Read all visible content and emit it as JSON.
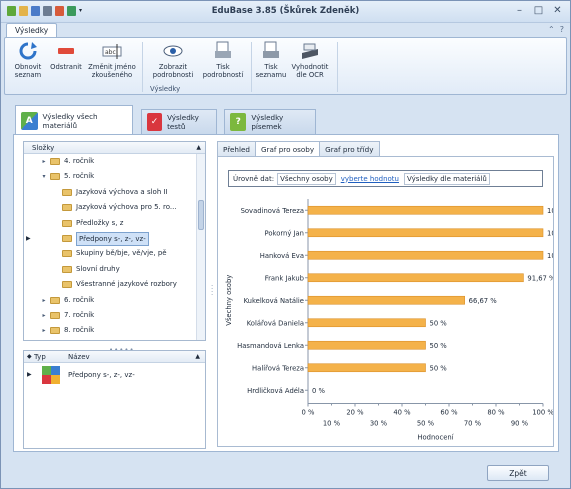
{
  "window": {
    "title": "EduBase 3.85 (Škůrek Zdeněk)"
  },
  "ribbon": {
    "tab": "Výsledky",
    "buttons": [
      {
        "label": "Obnovit seznam"
      },
      {
        "label": "Odstranit"
      },
      {
        "label": "Změnit jméno zkoušeného"
      },
      {
        "label": "Zobrazit podrobnosti"
      },
      {
        "label": "Tisk podrobností"
      },
      {
        "label": "Tisk seznamu"
      },
      {
        "label": "Vyhodnotit dle OCR"
      }
    ],
    "group_label": "Výsledky"
  },
  "main_tabs": [
    {
      "label": "Výsledky všech materiálů",
      "active": true
    },
    {
      "label": "Výsledky testů",
      "active": false
    },
    {
      "label": "Výsledky písemek",
      "active": false
    }
  ],
  "tree": {
    "header": "Složky",
    "rows": [
      {
        "label": "4. ročník",
        "level": 1,
        "expander": "▸"
      },
      {
        "label": "5. ročník",
        "level": 1,
        "expander": "▾"
      },
      {
        "label": "Jazyková výchova a sloh II",
        "level": 2,
        "expander": ""
      },
      {
        "label": "Jazyková výchova pro 5. ro...",
        "level": 2,
        "expander": ""
      },
      {
        "label": "Předložky s, z",
        "level": 2,
        "expander": ""
      },
      {
        "label": "Předpony s-, z-, vz-",
        "level": 2,
        "expander": "",
        "selected": true
      },
      {
        "label": "Skupiny bě/bje, vě/vje, pě",
        "level": 2,
        "expander": ""
      },
      {
        "label": "Slovní druhy",
        "level": 2,
        "expander": ""
      },
      {
        "label": "Všestranné jazykové rozbory",
        "level": 2,
        "expander": ""
      },
      {
        "label": "6. ročník",
        "level": 1,
        "expander": "▸"
      },
      {
        "label": "7. ročník",
        "level": 1,
        "expander": "▸"
      },
      {
        "label": "8. ročník",
        "level": 1,
        "expander": "▸"
      },
      {
        "label": "9. ročník",
        "level": 1,
        "expander": "▸"
      }
    ]
  },
  "list": {
    "columns": {
      "type": "Typ",
      "name": "Název"
    },
    "rows": [
      {
        "name": "Předpony s-, z-, vz-"
      }
    ]
  },
  "results": {
    "tabs": [
      {
        "label": "Přehled",
        "active": false
      },
      {
        "label": "Graf pro osoby",
        "active": true
      },
      {
        "label": "Graf pro třídy",
        "active": false
      }
    ],
    "levels": {
      "label": "Úrovně dat:",
      "items": [
        "Všechny osoby",
        "vyberte hodnotu",
        "Výsledky dle materiálů"
      ]
    }
  },
  "chart_data": {
    "type": "bar",
    "orientation": "horizontal",
    "categories": [
      "Sovadinová Tereza",
      "Pokorný Jan",
      "Hanková Eva",
      "Frank Jakub",
      "Kukelková Natálie",
      "Kolářová Daniela",
      "Hasmandová Lenka",
      "Halířová Tereza",
      "Hrdličková Adéla"
    ],
    "values": [
      100,
      100,
      100,
      91.67,
      66.67,
      50,
      50,
      50,
      0
    ],
    "value_labels": [
      "100 %",
      "100 %",
      "100 %",
      "91,67 %",
      "66,67 %",
      "50 %",
      "50 %",
      "50 %",
      "0 %"
    ],
    "xlabel": "Hodnocení",
    "ylabel": "Všechny osoby",
    "xlim": [
      0,
      100
    ],
    "ticks_major": [
      "0 %",
      "20 %",
      "40 %",
      "60 %",
      "80 %",
      "100 %"
    ],
    "ticks_minor": [
      "10 %",
      "30 %",
      "50 %",
      "70 %",
      "90 %"
    ],
    "bar_color": "#f4b24a",
    "grid": false
  },
  "footer": {
    "back_button": "Zpět"
  }
}
